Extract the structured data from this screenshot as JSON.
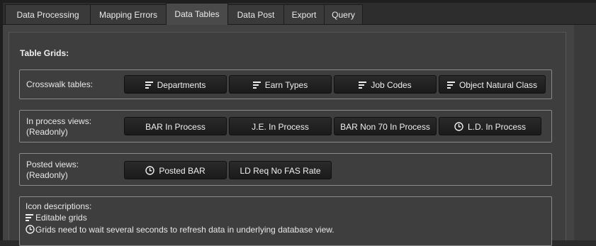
{
  "tabs": [
    {
      "label": "Data Processing",
      "active": false
    },
    {
      "label": "Mapping Errors",
      "active": false
    },
    {
      "label": "Data Tables",
      "active": true
    },
    {
      "label": "Data Post",
      "active": false
    },
    {
      "label": "Export",
      "active": false
    },
    {
      "label": "Query",
      "active": false
    }
  ],
  "section_title": "Table Grids:",
  "crosswalk": {
    "label": "Crosswalk tables:",
    "buttons": [
      {
        "label": "Departments",
        "icon": "editable-grid-icon"
      },
      {
        "label": "Earn Types",
        "icon": "editable-grid-icon"
      },
      {
        "label": "Job Codes",
        "icon": "editable-grid-icon"
      },
      {
        "label": "Object Natural Class",
        "icon": "editable-grid-icon"
      }
    ]
  },
  "in_process": {
    "label_line1": "In process views:",
    "label_line2": "(Readonly)",
    "buttons": [
      {
        "label": "BAR In Process",
        "icon": ""
      },
      {
        "label": "J.E. In Process",
        "icon": ""
      },
      {
        "label": "BAR Non 70 In Process",
        "icon": ""
      },
      {
        "label": "L.D. In Process",
        "icon": "clock-icon"
      }
    ]
  },
  "posted": {
    "label_line1": "Posted views:",
    "label_line2": "(Readonly)",
    "buttons": [
      {
        "label": "Posted BAR",
        "icon": "clock-icon"
      },
      {
        "label": "LD Req No FAS Rate",
        "icon": ""
      }
    ]
  },
  "icon_descriptions": {
    "heading": "Icon descriptions:",
    "editable": "Editable grids",
    "wait": "Grids need to wait several seconds to refresh data in underlying database view."
  }
}
